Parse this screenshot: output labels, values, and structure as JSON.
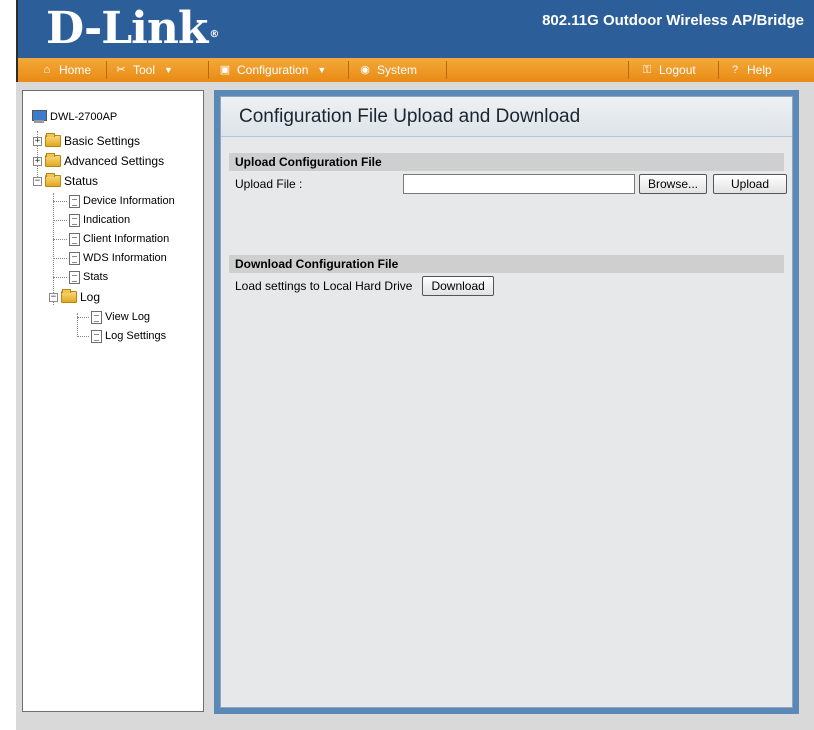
{
  "header": {
    "logo": "D-Link",
    "logo_mark": "®",
    "product_title": "802.11G Outdoor Wireless AP/Bridge"
  },
  "menu": {
    "home": "Home",
    "tool": "Tool",
    "configuration": "Configuration",
    "system": "System",
    "logout": "Logout",
    "help": "Help"
  },
  "tree": {
    "root": "DWL-2700AP",
    "basic_settings": "Basic Settings",
    "advanced_settings": "Advanced Settings",
    "status": "Status",
    "device_information": "Device Information",
    "indication": "Indication",
    "client_information": "Client Information",
    "wds_information": "WDS Information",
    "stats": "Stats",
    "log": "Log",
    "view_log": "View Log",
    "log_settings": "Log Settings"
  },
  "main": {
    "title": "Configuration File Upload and Download",
    "upload_section": "Upload Configuration File",
    "upload_label": "Upload File :",
    "upload_file_value": "",
    "browse_button": "Browse...",
    "upload_button": "Upload",
    "download_section": "Download Configuration File",
    "download_label": "Load settings to Local Hard Drive",
    "download_button": "Download"
  },
  "colors": {
    "header_blue": "#2c5f99",
    "menu_orange": "#e98a14",
    "panel_blue": "#5a89b8"
  }
}
